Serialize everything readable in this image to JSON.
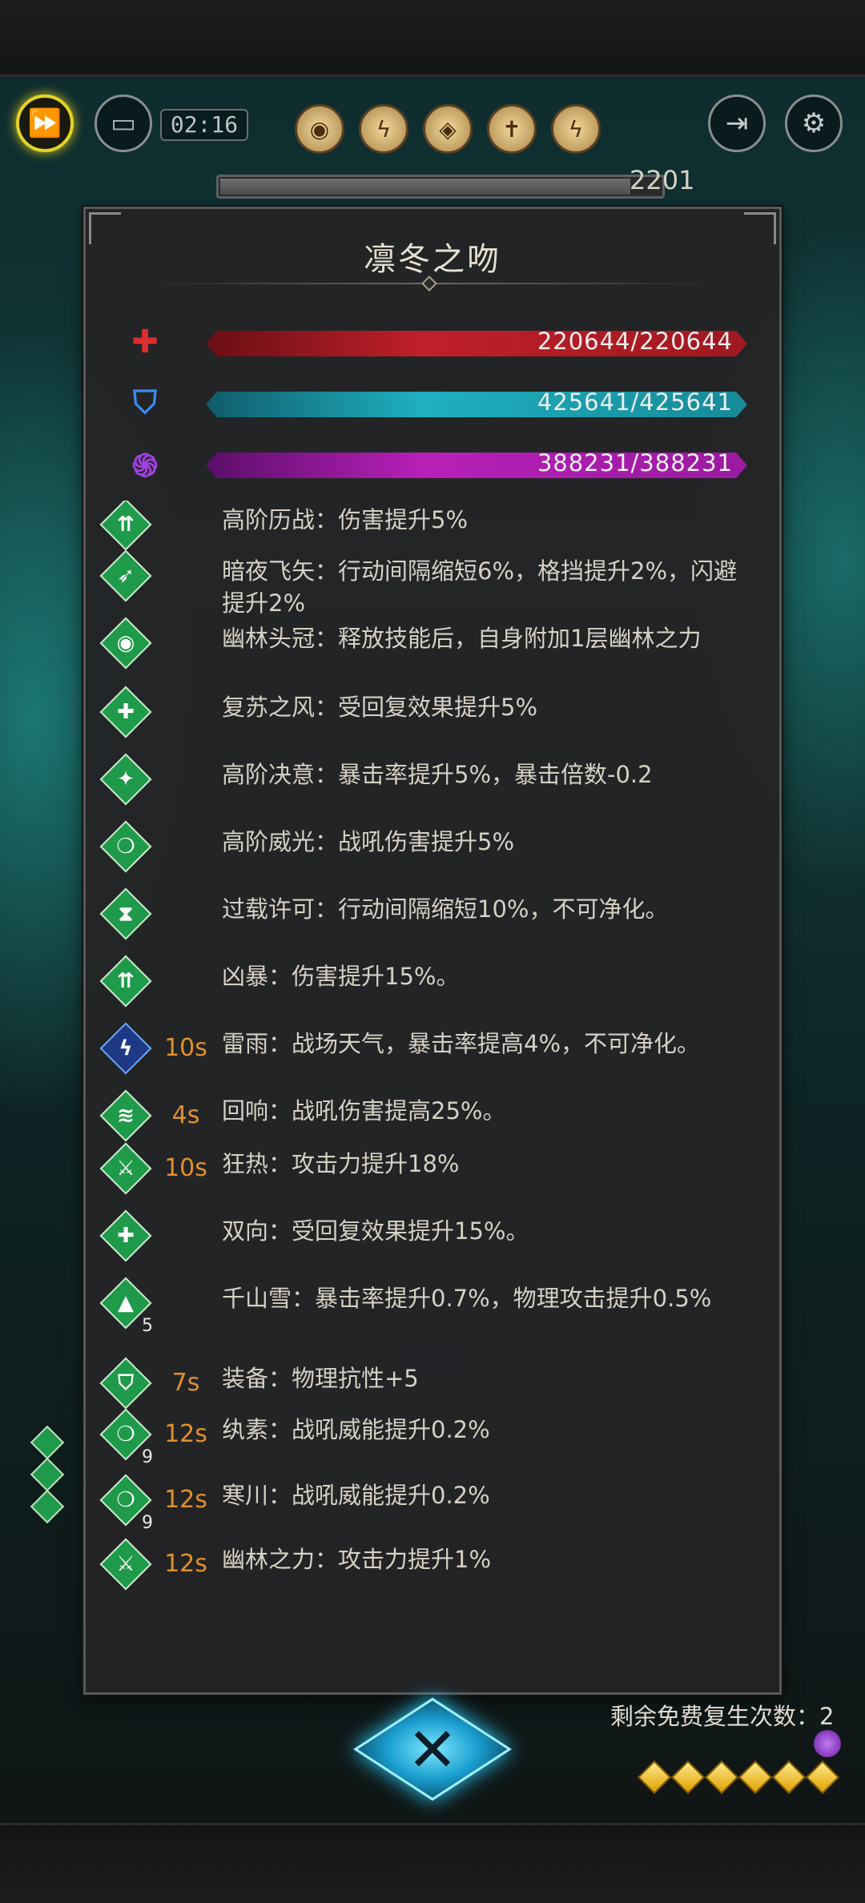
{
  "header": {
    "timer": "02:16",
    "progress_number": "2201",
    "progress_fraction": 0.93
  },
  "panel": {
    "title": "凛冬之吻",
    "stats": [
      {
        "name": "health",
        "value": "220644/220644",
        "icon": "red-cross-icon",
        "color": "#c0202a"
      },
      {
        "name": "shield",
        "value": "425641/425641",
        "icon": "blue-shield-icon",
        "color": "#1f9fb0"
      },
      {
        "name": "energy",
        "value": "388231/388231",
        "icon": "purple-swirl-icon",
        "color": "#b020b0"
      }
    ],
    "buffs": [
      {
        "icon": "green-attack-up-icon",
        "duration": "",
        "stack": "",
        "text": "高阶历战：伤害提升5%"
      },
      {
        "icon": "green-arrows-icon",
        "duration": "",
        "stack": "",
        "text": "暗夜飞矢：行动间隔缩短6%，格挡提升2%，闪避提升2%"
      },
      {
        "icon": "green-eye-icon",
        "duration": "",
        "stack": "",
        "text": "幽林头冠：释放技能后，自身附加1层幽林之力"
      },
      {
        "icon": "green-heal-up-icon",
        "duration": "",
        "stack": "",
        "text": "复苏之风：受回复效果提升5%"
      },
      {
        "icon": "green-crit-icon",
        "duration": "",
        "stack": "",
        "text": "高阶决意：暴击率提升5%，暴击倍数-0.2"
      },
      {
        "icon": "green-warcry-icon",
        "duration": "",
        "stack": "",
        "text": "高阶威光：战吼伤害提升5%"
      },
      {
        "icon": "green-hourglass-icon",
        "duration": "",
        "stack": "",
        "text": "过载许可：行动间隔缩短10%，不可净化。"
      },
      {
        "icon": "green-attack-up-icon",
        "duration": "",
        "stack": "",
        "text": "凶暴：伤害提升15%。"
      },
      {
        "icon": "blue-lightning-icon",
        "duration": "10s",
        "stack": "",
        "text": "雷雨：战场天气，暴击率提高4%，不可净化。"
      },
      {
        "icon": "green-echo-icon",
        "duration": "4s",
        "stack": "",
        "text": "回响：战吼伤害提高25%。"
      },
      {
        "icon": "green-swords-icon",
        "duration": "10s",
        "stack": "",
        "text": "狂热：攻击力提升18%"
      },
      {
        "icon": "green-heal-up-icon",
        "duration": "",
        "stack": "",
        "text": "双向：受回复效果提升15%。"
      },
      {
        "icon": "green-snow-mountain-icon",
        "duration": "",
        "stack": "5",
        "text": "千山雪：暴击率提升0.7%，物理攻击提升0.5%"
      },
      {
        "icon": "green-shield-icon",
        "duration": "7s",
        "stack": "",
        "text": "装备：物理抗性+5"
      },
      {
        "icon": "green-warcry-icon",
        "duration": "12s",
        "stack": "9",
        "text": "纨素：战吼威能提升0.2%"
      },
      {
        "icon": "green-warcry-icon",
        "duration": "12s",
        "stack": "9",
        "text": "寒川：战吼威能提升0.2%"
      },
      {
        "icon": "green-swords-icon",
        "duration": "12s",
        "stack": "",
        "text": "幽林之力：攻击力提升1%"
      }
    ]
  },
  "footer": {
    "revive_text": "剩余免费复生次数：2",
    "revive_diamonds": 6
  },
  "colors": {
    "buff_green": "#1f9a4a",
    "duration_orange": "#e0902e",
    "fast_forward_yellow": "#e3d326"
  }
}
